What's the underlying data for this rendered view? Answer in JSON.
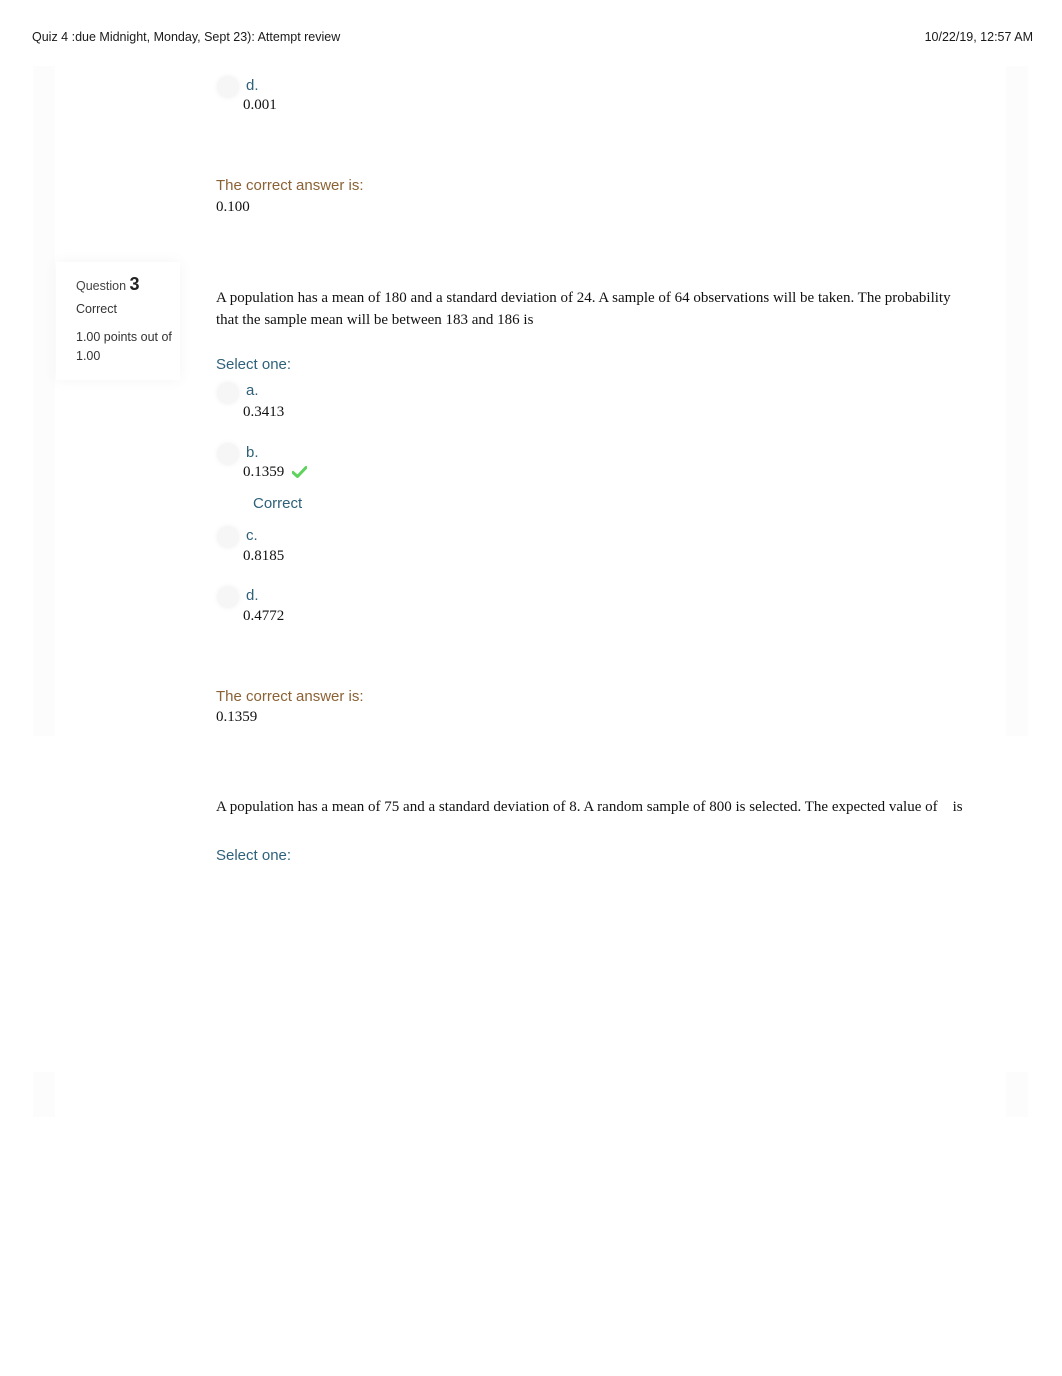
{
  "page": {
    "title": "Quiz 4 :due Midnight, Monday, Sept 23): Attempt review",
    "timestamp": "10/22/19, 12:57 AM"
  },
  "question2_tail": {
    "option_d": {
      "letter": "d.",
      "value": "0.001"
    },
    "correct_answer_label": "The correct answer is:",
    "correct_answer": "0.100"
  },
  "question3": {
    "label": "Question",
    "number": "3",
    "state": "Correct",
    "grade": "1.00 points out of 1.00",
    "text": "A population has a mean of 180 and a standard deviation of 24. A sample of 64 observations will be taken. The probability that the sample mean will be between 183 and 186 is",
    "select_label": "Select one:",
    "options": [
      {
        "letter": "a.",
        "value": "0.3413",
        "selected": false
      },
      {
        "letter": "b.",
        "value": "0.1359",
        "selected": true,
        "feedback": "Correct"
      },
      {
        "letter": "c.",
        "value": "0.8185",
        "selected": false
      },
      {
        "letter": "d.",
        "value": "0.4772",
        "selected": false
      }
    ],
    "correct_answer_label": "The correct answer is:",
    "correct_answer": "0.1359",
    "check_color": "#5dd35d"
  },
  "question4": {
    "text": "A population has a mean of 75 and a standard deviation of 8. A random sample of 800 is selected. The expected value of    is",
    "select_label": "Select one:"
  }
}
